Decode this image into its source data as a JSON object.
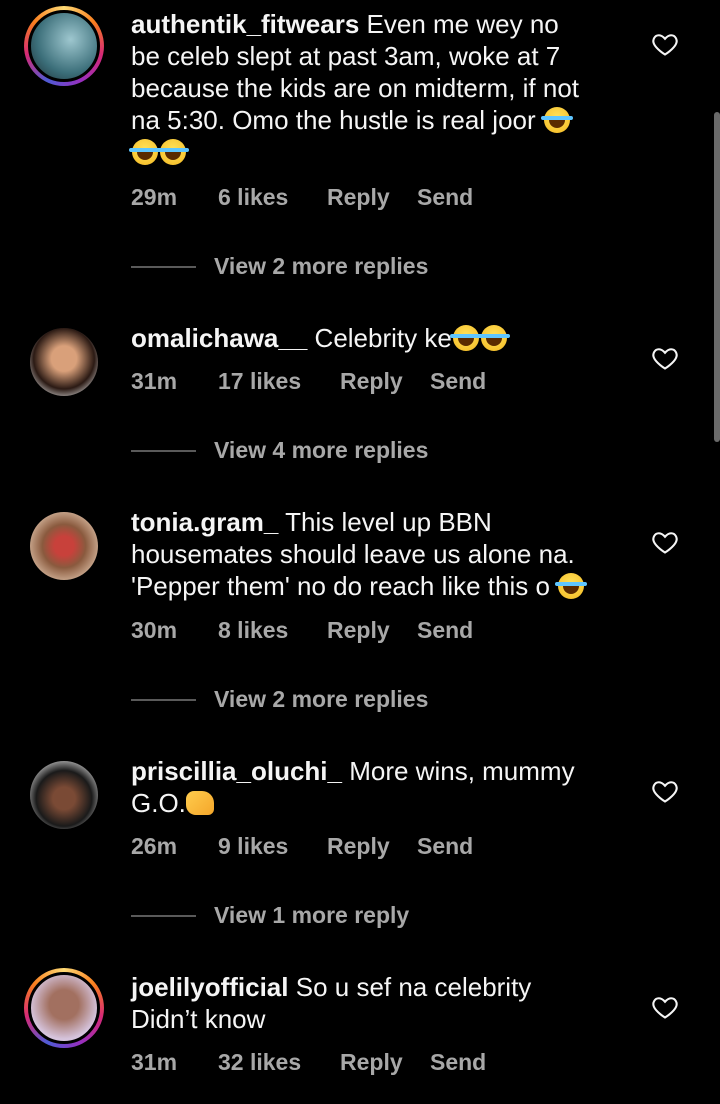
{
  "comments": [
    {
      "username": "authentik_fitwears",
      "text_lines": [
        "Even me wey no",
        "be celeb slept at past 3am, woke at 7",
        "because the kids are on midterm, if not",
        "na 5:30. Omo the hustle is real joor "
      ],
      "emoji_line": "",
      "time": "29m",
      "likes": "6 likes",
      "reply": "Reply",
      "send": "Send",
      "view_more": "View 2 more replies"
    },
    {
      "username": "omalichawa__",
      "text_lines": [
        "Celebrity ke"
      ],
      "time": "31m",
      "likes": "17 likes",
      "reply": "Reply",
      "send": "Send",
      "view_more": "View 4 more replies"
    },
    {
      "username": "tonia.gram_",
      "text_lines": [
        "This level up BBN",
        "housemates should leave us alone na.",
        "'Pepper them' no do reach like this o "
      ],
      "time": "30m",
      "likes": "8 likes",
      "reply": "Reply",
      "send": "Send",
      "view_more": "View 2 more replies"
    },
    {
      "username": "priscillia_oluchi_",
      "text_lines": [
        "More wins, mummy",
        "G.O."
      ],
      "time": "26m",
      "likes": "9 likes",
      "reply": "Reply",
      "send": "Send",
      "view_more": "View 1 more reply"
    },
    {
      "username": "joelilyofficial",
      "text_lines": [
        "So u sef na celebrity",
        "Didn’t know"
      ],
      "time": "31m",
      "likes": "32 likes",
      "reply": "Reply",
      "send": "Send"
    }
  ],
  "colors": {
    "background": "#000000",
    "text": "#f5f5f5",
    "muted": "#a8a8a8"
  },
  "icons": [
    "heart-icon",
    "face-with-tears-of-joy-emoji",
    "handshake-emoji"
  ]
}
